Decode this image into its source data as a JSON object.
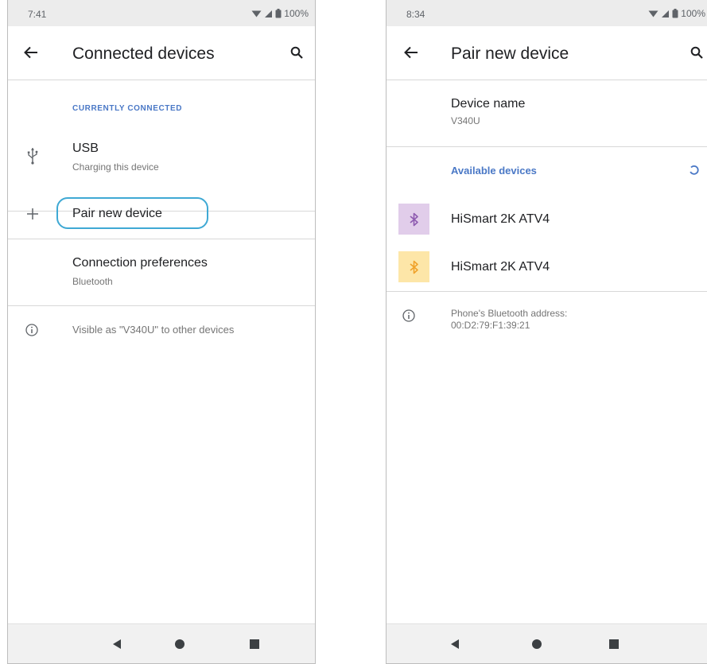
{
  "left_screen": {
    "status": {
      "time": "7:41",
      "battery": "100%"
    },
    "app_bar": {
      "title": "Connected devices",
      "back_icon": "arrow-back-icon",
      "search_icon": "search-icon"
    },
    "section_header": "CURRENTLY CONNECTED",
    "usb": {
      "title": "USB",
      "subtitle": "Charging this device",
      "icon": "usb-icon"
    },
    "pair_new": {
      "title": "Pair new device",
      "icon": "plus-icon",
      "highlight_color": "#3fa9d4"
    },
    "connection_prefs": {
      "title": "Connection preferences",
      "subtitle": "Bluetooth"
    },
    "visible_info": {
      "text": "Visible as \"V340U\" to other devices",
      "icon": "info-icon"
    }
  },
  "right_screen": {
    "status": {
      "time": "8:34",
      "battery": "100%"
    },
    "app_bar": {
      "title": "Pair new device",
      "back_icon": "arrow-back-icon",
      "search_icon": "search-icon"
    },
    "device_name": {
      "title": "Device name",
      "value": "V340U"
    },
    "available_header": "Available devices",
    "refresh_icon": "refresh-spinner-icon",
    "devices": [
      {
        "name": "HiSmart 2K ATV4",
        "icon": "bluetooth-icon",
        "tile_color": "#e1cdea",
        "icon_color": "#8e5bb0"
      },
      {
        "name": "HiSmart 2K ATV4",
        "icon": "bluetooth-icon",
        "tile_color": "#fde6a8",
        "icon_color": "#f0a22b"
      }
    ],
    "address_info": {
      "label": "Phone's Bluetooth address:",
      "value": "00:D2:79:F1:39:21",
      "icon": "info-icon"
    }
  },
  "nav": {
    "back": "nav-back-icon",
    "home": "nav-home-icon",
    "recents": "nav-recents-icon"
  },
  "colors": {
    "accent": "#4a78c6",
    "status_bar": "#ececec",
    "nav_bar": "#f1f1f1"
  }
}
